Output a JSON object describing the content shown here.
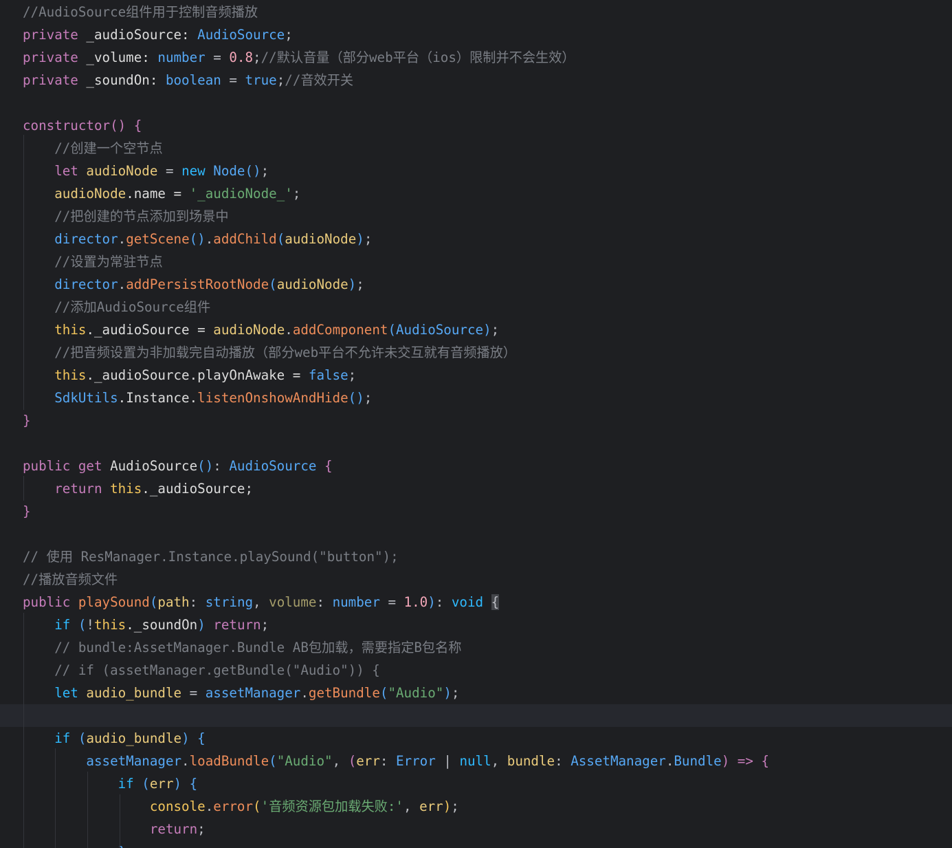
{
  "editor": {
    "lines": [
      [
        {
          "t": "//AudioSource组件用于控制音频播放",
          "c": "comment"
        }
      ],
      [
        {
          "t": "private",
          "c": "kw"
        },
        {
          "t": " _audioSource: ",
          "c": "prop"
        },
        {
          "t": "AudioSource",
          "c": "type"
        },
        {
          "t": ";",
          "c": "op"
        }
      ],
      [
        {
          "t": "private",
          "c": "kw"
        },
        {
          "t": " _volume: ",
          "c": "prop"
        },
        {
          "t": "number",
          "c": "type"
        },
        {
          "t": " = ",
          "c": "op"
        },
        {
          "t": "0.8",
          "c": "number"
        },
        {
          "t": ";",
          "c": "op"
        },
        {
          "t": "//默认音量（部分web平台（ios）限制并不会生效）",
          "c": "comment"
        }
      ],
      [
        {
          "t": "private",
          "c": "kw"
        },
        {
          "t": " _soundOn: ",
          "c": "prop"
        },
        {
          "t": "boolean",
          "c": "type"
        },
        {
          "t": " = ",
          "c": "op"
        },
        {
          "t": "true",
          "c": "bool"
        },
        {
          "t": ";",
          "c": "op"
        },
        {
          "t": "//音效开关",
          "c": "comment"
        }
      ],
      [],
      [
        {
          "t": "constructor",
          "c": "kw"
        },
        {
          "t": "() {",
          "c": "bracket"
        }
      ],
      [
        {
          "t": "    "
        },
        {
          "t": "//创建一个空节点",
          "c": "comment"
        }
      ],
      [
        {
          "t": "    "
        },
        {
          "t": "let",
          "c": "kw"
        },
        {
          "t": " audioNode",
          "c": "var"
        },
        {
          "t": " = ",
          "c": "op"
        },
        {
          "t": "new",
          "c": "kw2"
        },
        {
          "t": " Node",
          "c": "type"
        },
        {
          "t": "()",
          "c": "paren"
        },
        {
          "t": ";",
          "c": "op"
        }
      ],
      [
        {
          "t": "    "
        },
        {
          "t": "audioNode",
          "c": "var"
        },
        {
          "t": ".name = ",
          "c": "prop"
        },
        {
          "t": "'_audioNode_'",
          "c": "string"
        },
        {
          "t": ";",
          "c": "op"
        }
      ],
      [
        {
          "t": "    "
        },
        {
          "t": "//把创建的节点添加到场景中",
          "c": "comment"
        }
      ],
      [
        {
          "t": "    "
        },
        {
          "t": "director",
          "c": "type"
        },
        {
          "t": ".",
          "c": "op"
        },
        {
          "t": "getScene",
          "c": "method"
        },
        {
          "t": "()",
          "c": "paren"
        },
        {
          "t": ".",
          "c": "op"
        },
        {
          "t": "addChild",
          "c": "method"
        },
        {
          "t": "(",
          "c": "paren"
        },
        {
          "t": "audioNode",
          "c": "var"
        },
        {
          "t": ")",
          "c": "paren"
        },
        {
          "t": ";",
          "c": "op"
        }
      ],
      [
        {
          "t": "    "
        },
        {
          "t": "//设置为常驻节点",
          "c": "comment"
        }
      ],
      [
        {
          "t": "    "
        },
        {
          "t": "director",
          "c": "type"
        },
        {
          "t": ".",
          "c": "op"
        },
        {
          "t": "addPersistRootNode",
          "c": "method"
        },
        {
          "t": "(",
          "c": "paren"
        },
        {
          "t": "audioNode",
          "c": "var"
        },
        {
          "t": ")",
          "c": "paren"
        },
        {
          "t": ";",
          "c": "op"
        }
      ],
      [
        {
          "t": "    "
        },
        {
          "t": "//添加AudioSource组件",
          "c": "comment"
        }
      ],
      [
        {
          "t": "    "
        },
        {
          "t": "this",
          "c": "fn"
        },
        {
          "t": "._audioSource = ",
          "c": "prop"
        },
        {
          "t": "audioNode",
          "c": "var"
        },
        {
          "t": ".",
          "c": "op"
        },
        {
          "t": "addComponent",
          "c": "method"
        },
        {
          "t": "(",
          "c": "paren"
        },
        {
          "t": "AudioSource",
          "c": "type"
        },
        {
          "t": ")",
          "c": "paren"
        },
        {
          "t": ";",
          "c": "op"
        }
      ],
      [
        {
          "t": "    "
        },
        {
          "t": "//把音频设置为非加载完自动播放（部分web平台不允许未交互就有音频播放）",
          "c": "comment"
        }
      ],
      [
        {
          "t": "    "
        },
        {
          "t": "this",
          "c": "fn"
        },
        {
          "t": "._audioSource.playOnAwake = ",
          "c": "prop"
        },
        {
          "t": "false",
          "c": "bool"
        },
        {
          "t": ";",
          "c": "op"
        }
      ],
      [
        {
          "t": "    "
        },
        {
          "t": "SdkUtils",
          "c": "type"
        },
        {
          "t": ".Instance.",
          "c": "prop"
        },
        {
          "t": "listenOnshowAndHide",
          "c": "method"
        },
        {
          "t": "()",
          "c": "paren"
        },
        {
          "t": ";",
          "c": "op"
        }
      ],
      [
        {
          "t": "}",
          "c": "bracket"
        }
      ],
      [],
      [
        {
          "t": "public",
          "c": "kw"
        },
        {
          "t": " get",
          "c": "kw"
        },
        {
          "t": " AudioSource",
          "c": "prop"
        },
        {
          "t": "()",
          "c": "paren"
        },
        {
          "t": ": ",
          "c": "op"
        },
        {
          "t": "AudioSource",
          "c": "type"
        },
        {
          "t": " {",
          "c": "bracket"
        }
      ],
      [
        {
          "t": "    "
        },
        {
          "t": "return",
          "c": "kw"
        },
        {
          "t": " this",
          "c": "fn"
        },
        {
          "t": "._audioSource;",
          "c": "prop"
        }
      ],
      [
        {
          "t": "}",
          "c": "bracket"
        }
      ],
      [],
      [
        {
          "t": "// 使用 ResManager.Instance.playSound(\"button\");",
          "c": "comment"
        }
      ],
      [
        {
          "t": "//播放音频文件",
          "c": "comment"
        }
      ],
      [
        {
          "t": "public",
          "c": "kw"
        },
        {
          "t": " playSound",
          "c": "method"
        },
        {
          "t": "(",
          "c": "paren"
        },
        {
          "t": "path",
          "c": "param"
        },
        {
          "t": ": ",
          "c": "op"
        },
        {
          "t": "string",
          "c": "type"
        },
        {
          "t": ", ",
          "c": "op"
        },
        {
          "t": "volume",
          "c": "unused"
        },
        {
          "t": ": ",
          "c": "op"
        },
        {
          "t": "number",
          "c": "type"
        },
        {
          "t": " = ",
          "c": "op"
        },
        {
          "t": "1.0",
          "c": "number"
        },
        {
          "t": ")",
          "c": "paren"
        },
        {
          "t": ": ",
          "c": "op"
        },
        {
          "t": "void",
          "c": "kw2"
        },
        {
          "t": " "
        },
        {
          "t": "{",
          "c": "bracematch"
        }
      ],
      [
        {
          "t": "    "
        },
        {
          "t": "if",
          "c": "kw2"
        },
        {
          "t": " (",
          "c": "paren"
        },
        {
          "t": "!",
          "c": "op"
        },
        {
          "t": "this",
          "c": "fn"
        },
        {
          "t": "._soundOn",
          "c": "prop"
        },
        {
          "t": ")",
          "c": "paren"
        },
        {
          "t": " return",
          "c": "kw"
        },
        {
          "t": ";",
          "c": "op"
        }
      ],
      [
        {
          "t": "    "
        },
        {
          "t": "// bundle:AssetManager.Bundle AB包加载，需要指定B包名称",
          "c": "comment"
        }
      ],
      [
        {
          "t": "    "
        },
        {
          "t": "// if (assetManager.getBundle(\"Audio\")) {",
          "c": "comment"
        }
      ],
      [
        {
          "t": "    "
        },
        {
          "t": "let",
          "c": "kw2"
        },
        {
          "t": " audio_bundle",
          "c": "var"
        },
        {
          "t": " = ",
          "c": "op"
        },
        {
          "t": "assetManager",
          "c": "type"
        },
        {
          "t": ".",
          "c": "op"
        },
        {
          "t": "getBundle",
          "c": "method"
        },
        {
          "t": "(",
          "c": "paren"
        },
        {
          "t": "\"Audio\"",
          "c": "string"
        },
        {
          "t": ")",
          "c": "paren"
        },
        {
          "t": ";",
          "c": "op"
        }
      ],
      [],
      [
        {
          "t": "    "
        },
        {
          "t": "if",
          "c": "kw2"
        },
        {
          "t": " (",
          "c": "paren"
        },
        {
          "t": "audio_bundle",
          "c": "var"
        },
        {
          "t": ")",
          "c": "paren"
        },
        {
          "t": " {",
          "c": "paren"
        }
      ],
      [
        {
          "t": "        "
        },
        {
          "t": "assetManager",
          "c": "type"
        },
        {
          "t": ".",
          "c": "op"
        },
        {
          "t": "loadBundle",
          "c": "method"
        },
        {
          "t": "(",
          "c": "paren"
        },
        {
          "t": "\"Audio\"",
          "c": "string"
        },
        {
          "t": ", ",
          "c": "op"
        },
        {
          "t": "(",
          "c": "bracket"
        },
        {
          "t": "err",
          "c": "param"
        },
        {
          "t": ": ",
          "c": "op"
        },
        {
          "t": "Error",
          "c": "type"
        },
        {
          "t": " | ",
          "c": "op"
        },
        {
          "t": "null",
          "c": "kw2"
        },
        {
          "t": ", ",
          "c": "op"
        },
        {
          "t": "bundle",
          "c": "param"
        },
        {
          "t": ": ",
          "c": "op"
        },
        {
          "t": "AssetManager",
          "c": "type"
        },
        {
          "t": ".",
          "c": "op"
        },
        {
          "t": "Bundle",
          "c": "type"
        },
        {
          "t": ")",
          "c": "bracket"
        },
        {
          "t": " => ",
          "c": "kw"
        },
        {
          "t": "{",
          "c": "bracket"
        }
      ],
      [
        {
          "t": "            "
        },
        {
          "t": "if",
          "c": "kw2"
        },
        {
          "t": " (",
          "c": "paren"
        },
        {
          "t": "err",
          "c": "param"
        },
        {
          "t": ")",
          "c": "paren"
        },
        {
          "t": " {",
          "c": "paren"
        }
      ],
      [
        {
          "t": "                "
        },
        {
          "t": "console",
          "c": "fn"
        },
        {
          "t": ".",
          "c": "op"
        },
        {
          "t": "error",
          "c": "method"
        },
        {
          "t": "(",
          "c": "fn"
        },
        {
          "t": "'音频资源包加载失败:'",
          "c": "string"
        },
        {
          "t": ", ",
          "c": "op"
        },
        {
          "t": "err",
          "c": "param"
        },
        {
          "t": ")",
          "c": "fn"
        },
        {
          "t": ";",
          "c": "op"
        }
      ],
      [
        {
          "t": "                "
        },
        {
          "t": "return",
          "c": "kw"
        },
        {
          "t": ";",
          "c": "op"
        }
      ],
      [
        {
          "t": "            "
        },
        {
          "t": "}",
          "c": "paren"
        }
      ]
    ]
  }
}
